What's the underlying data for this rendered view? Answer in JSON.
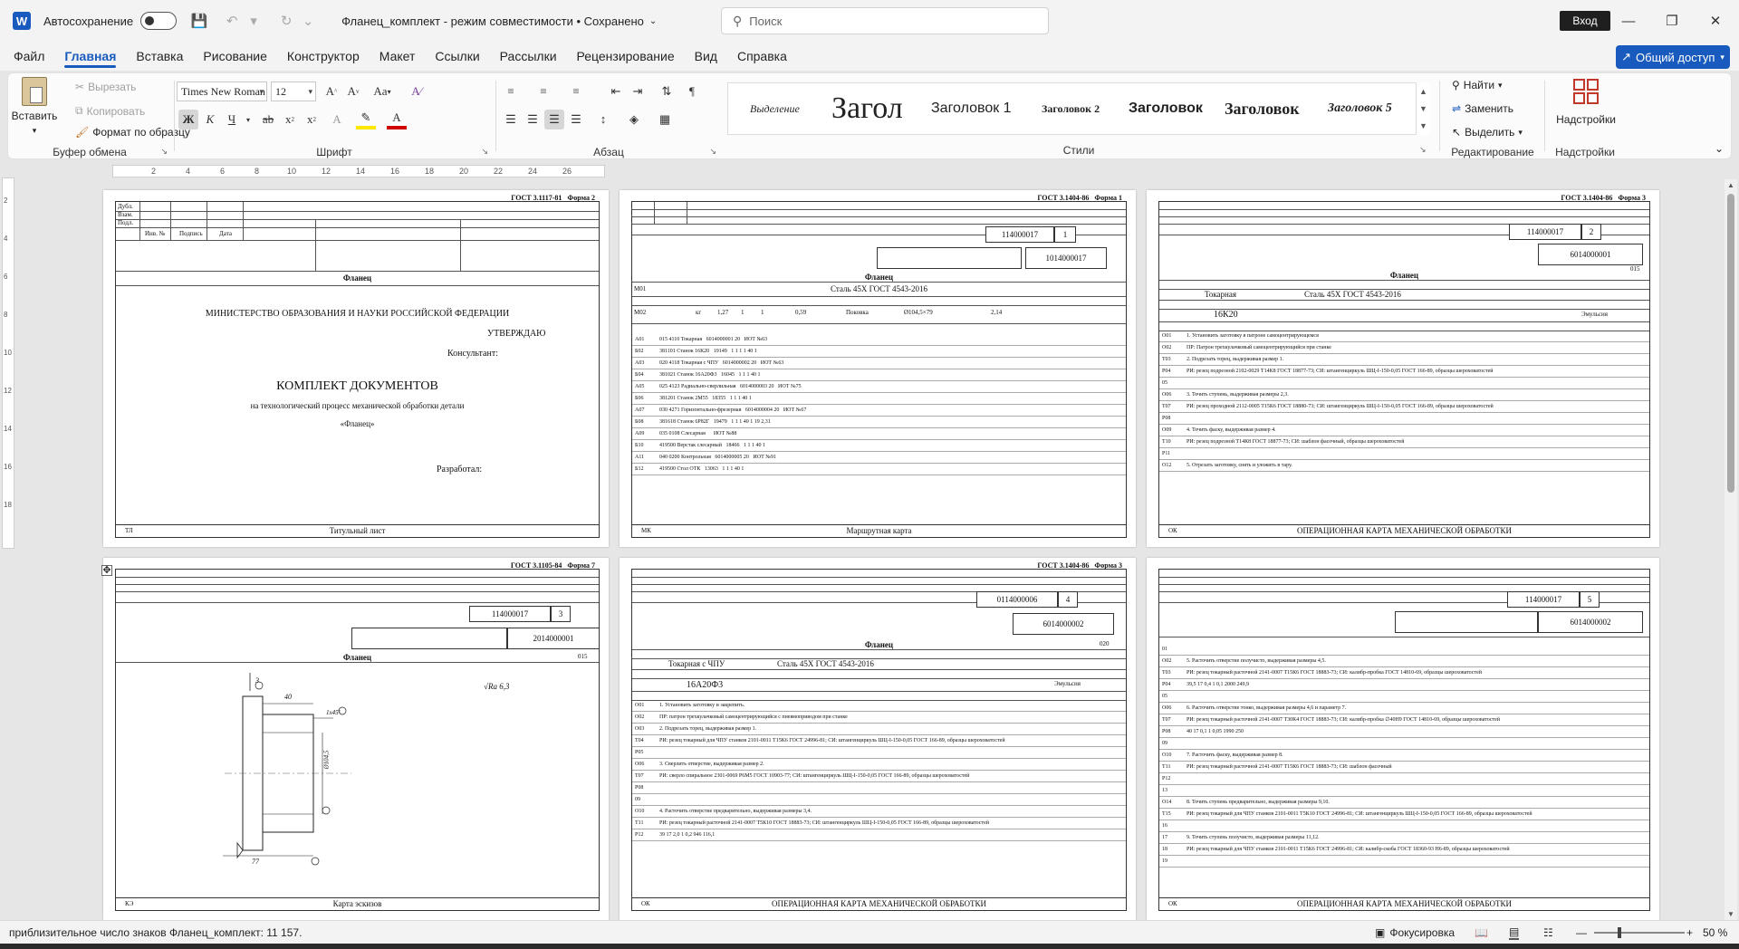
{
  "titlebar": {
    "app_icon": "W",
    "autosave_label": "Автосохранение",
    "doc_title": "Фланец_комплект  -  режим совместимости • Сохранено",
    "search_placeholder": "Поиск",
    "login_label": "Вход"
  },
  "menu": {
    "tabs": [
      "Файл",
      "Главная",
      "Вставка",
      "Рисование",
      "Конструктор",
      "Макет",
      "Ссылки",
      "Рассылки",
      "Рецензирование",
      "Вид",
      "Справка"
    ],
    "share_label": "Общий доступ"
  },
  "ribbon": {
    "clipboard": {
      "paste": "Вставить",
      "cut": "Вырезать",
      "copy": "Копировать",
      "format_painter": "Формат по образцу",
      "label": "Буфер обмена"
    },
    "font": {
      "font_name": "Times New Roman",
      "font_size": "12",
      "label": "Шрифт",
      "bold": "Ж",
      "italic": "К",
      "underline": "Ч"
    },
    "paragraph": {
      "label": "Абзац"
    },
    "styles": {
      "items": [
        "Выделение",
        "Загол",
        "Заголовок 1",
        "Заголовок 2",
        "Заголовок 3",
        "Заголовок",
        "Заголовок 5"
      ],
      "label": "Стили"
    },
    "editing": {
      "find": "Найти",
      "replace": "Заменить",
      "select": "Выделить",
      "label": "Редактирование"
    },
    "addins": {
      "button": "Надстройки",
      "label": "Надстройки"
    }
  },
  "ruler": {
    "marks": [
      "2",
      "4",
      "6",
      "8",
      "10",
      "12",
      "14",
      "16",
      "18",
      "20",
      "22",
      "24",
      "26"
    ]
  },
  "vruler": {
    "marks": [
      "2",
      "4",
      "6",
      "8",
      "10",
      "12",
      "14",
      "16",
      "18"
    ]
  },
  "pages": {
    "p1": {
      "gost": "ГОСТ 3.1117-81",
      "forma": "Форма 2",
      "part": "Фланец",
      "ministry": "МИНИСТЕРСТВО ОБРАЗОВАНИЯ И НАУКИ РОССИЙСКОЙ ФЕДЕРАЦИИ",
      "approve": "УТВЕРЖДАЮ",
      "consultant": "Консультант:",
      "title": "КОМПЛЕКТ ДОКУМЕНТОВ",
      "subtitle": "на технологический процесс механической обработки детали",
      "part_quoted": "«Фланец»",
      "developer": "Разработал:",
      "footer": "Титульный лист",
      "tl": "ТЛ",
      "labels": [
        "Дубл.",
        "Взам.",
        "Подл.",
        "Инв. №",
        "Подпись",
        "Дата"
      ]
    },
    "p2": {
      "gost": "ГОСТ 3.1404-86",
      "forma": "Форма 1",
      "doc1": "114000017",
      "sheet": "1",
      "doc2": "1014000017",
      "part": "Фланец",
      "material": "Сталь 45Х ГОСТ 4543-2016",
      "m01": "М01",
      "m02": "М02",
      "footer": "Маршрутная карта",
      "mk": "МК",
      "mat_vals": [
        "кг",
        "1,27",
        "1",
        "1",
        "0,59",
        "Поковка",
        "Ø104,5×79",
        "2,14"
      ],
      "rows": [
        [
          "А01",
          "015 4110 Токарная",
          "6014000001 20",
          "ИОТ №63"
        ],
        [
          "Б02",
          "381101 Станок 16К20",
          "19149",
          "1 1 1 1 40 1"
        ],
        [
          "А03",
          "020 4118 Токарная с ЧПУ",
          "6014000002 20",
          "ИОТ №63"
        ],
        [
          "Б04",
          "381021 Станок 16А20Ф3",
          "16045",
          "1 1 1 40 1"
        ],
        [
          "А05",
          "025 4123 Радиально-сверлильная",
          "6014000003 20",
          "ИОТ №75"
        ],
        [
          "Б06",
          "381201 Станок 2М55",
          "18355",
          "1 1 1 40 1"
        ],
        [
          "А07",
          "030 4271 Горизонтально-фрезерная",
          "6014000004 20",
          "ИОТ №67"
        ],
        [
          "Б08",
          "381618 Станок 6Р82Г",
          "19479",
          "1 1 1 40 1 19 2,31"
        ],
        [
          "А09",
          "035 0108 Слесарная",
          "",
          "ИОТ №88"
        ],
        [
          "Б10",
          "419500 Верстак слесарный",
          "18466",
          "1 1 1 40 1"
        ],
        [
          "А11",
          "040 0200 Контрольная",
          "6014000005 20",
          "ИОТ №91"
        ],
        [
          "Б12",
          "419500 Стол ОТК",
          "13063",
          "1 1 1 40 1"
        ]
      ]
    },
    "p3": {
      "gost": "ГОСТ 3.1404-86",
      "forma": "Форма 3",
      "doc1": "114000017",
      "sheet": "2",
      "doc2": "6014000001",
      "part": "Фланец",
      "op_no": "015",
      "operation": "Токарная",
      "material": "Сталь 45Х ГОСТ 4543-2016",
      "equipment": "16К20",
      "coolant": "Эмульсия",
      "footer": "ОПЕРАЦИОННАЯ КАРТА МЕХАНИЧЕСКОЙ ОБРАБОТКИ",
      "ok": "ОК",
      "rows": [
        [
          "О01",
          "1. Установить заготовку в патроне самоцентрирующемся"
        ],
        [
          "О02",
          "ПР: Патрон трехкулачковый самоцентрирующийся при станке"
        ],
        [
          "Т03",
          "2. Подрезать торец, выдерживая размер 1."
        ],
        [
          "Р04",
          "РИ: резец подрезной 2102-0029 Т14К8 ГОСТ 18877-73;  СИ: штангенциркуль ШЦ-I-150-0,05 ГОСТ 166-89, образцы шероховатостей"
        ],
        [
          "05",
          ""
        ],
        [
          "О06",
          "3. Точить ступень, выдерживая размеры 2,3."
        ],
        [
          "Т07",
          "РИ: резец проходной 2112-0005 Т15К6 ГОСТ 18880-73;  СИ: штангенциркуль ШЦ-I-150-0,05 ГОСТ 166-89, образцы шероховатостей"
        ],
        [
          "Р08",
          ""
        ],
        [
          "О09",
          "4. Точить фаску, выдерживая размер 4."
        ],
        [
          "Т10",
          "РИ: резец подрезной Т14К8 ГОСТ 18877-73;  СИ: шаблон фасочный, образцы шероховатостей"
        ],
        [
          "Р11",
          ""
        ],
        [
          "О12",
          "5. Отрезать заготовку, снять и уложить в тару."
        ]
      ]
    },
    "p4": {
      "gost": "ГОСТ 3.1105-84",
      "forma": "Форма 7",
      "doc1": "114000017",
      "sheet": "3",
      "doc2": "2014000001",
      "part": "Фланец",
      "op_no": "015",
      "roughness": "Ra 6,3",
      "dims": [
        "40",
        "1х45°",
        "Ø104,5",
        "77",
        "3"
      ],
      "footer": "Карта эскизов",
      "ke": "КЭ"
    },
    "p5": {
      "gost": "ГОСТ 3.1404-86",
      "forma": "Форма 3",
      "doc1": "0114000006",
      "sheet": "4",
      "doc2": "6014000002",
      "part": "Фланец",
      "op_no": "020",
      "operation": "Токарная с ЧПУ",
      "material": "Сталь 45Х ГОСТ 4543-2016",
      "equipment": "16А20Ф3",
      "coolant": "Эмульсия",
      "footer": "ОПЕРАЦИОННАЯ КАРТА МЕХАНИЧЕСКОЙ ОБРАБОТКИ",
      "ok": "ОК",
      "rows": [
        [
          "О01",
          "1. Установить заготовку и закрепить."
        ],
        [
          "О02",
          "ПР: патрон трехкулачковый самоцентрирующийся с пневмоприводом при станке"
        ],
        [
          "О03",
          "2. Подрезать торец, выдерживая размер 1."
        ],
        [
          "Т04",
          "РИ: резец токарный для ЧПУ станков 2101-0011 Т15К6 ГОСТ 24996-81;  СИ: штангенциркуль ШЦ-I-150-0,05 ГОСТ 166-89, образцы шероховатостей"
        ],
        [
          "Р05",
          ""
        ],
        [
          "О06",
          "3. Сверлить отверстие, выдерживая размер 2."
        ],
        [
          "Т07",
          "РИ: сверло спиральное 2301-0069 Р6М5 ГОСТ 10903-77;  СИ: штангенциркуль ШЦ-I-150-0,05 ГОСТ 166-89, образцы шероховатостей"
        ],
        [
          "Р08",
          ""
        ],
        [
          "09",
          ""
        ],
        [
          "О10",
          "4. Расточить отверстие предварительно, выдерживая размеры 3,4."
        ],
        [
          "Т11",
          "РИ: резец токарный расточной 2141-0007 Т5К10 ГОСТ 18883-73;  СИ: штангенциркуль ШЦ-I-150-0,05 ГОСТ 166-89, образцы шероховатостей"
        ],
        [
          "Р12",
          "39    17    2,0    1    0,2    946    116,1"
        ]
      ]
    },
    "p6": {
      "doc1": "114000017",
      "sheet": "5",
      "doc2": "6014000002",
      "footer": "ОПЕРАЦИОННАЯ КАРТА МЕХАНИЧЕСКОЙ ОБРАБОТКИ",
      "ok": "ОК",
      "rows": [
        [
          "01",
          ""
        ],
        [
          "О02",
          "5. Расточить отверстие получисто, выдерживая размеры 4,5."
        ],
        [
          "Т03",
          "РИ: резец токарный расточной 2141-0007 Т15К6 ГОСТ 18883-73;  СИ: калибр-пробка ГОСТ 14810-69, образцы шероховатостей"
        ],
        [
          "Р04",
          "39,5   17   0,4   1   0,1   2000   249,9"
        ],
        [
          "05",
          ""
        ],
        [
          "О06",
          "6. Расточить отверстие тонко, выдерживая размеры 4,6 и параметр 7."
        ],
        [
          "Т07",
          "РИ: резец токарный расточной 2141-0007 Т30К4 ГОСТ 18883-73;  СИ: калибр-пробка ∅40Н9 ГОСТ 14810-69, образцы шероховатостей"
        ],
        [
          "Р08",
          "40   17   0,1   1   0,05   1990   250"
        ],
        [
          "09",
          ""
        ],
        [
          "О10",
          "7. Расточить фаску, выдерживая размер 8."
        ],
        [
          "Т11",
          "РИ: резец токарный расточной 2141-0007 Т15К6 ГОСТ 18883-73;  СИ: шаблон фасочный"
        ],
        [
          "Р12",
          ""
        ],
        [
          "13",
          ""
        ],
        [
          "О14",
          "8. Точить ступень предварительно, выдерживая размеры 9,10."
        ],
        [
          "Т15",
          "РИ: резец токарный для ЧПУ станков 2101-0011 Т5К10 ГОСТ 24996-81;  СИ: штангенциркуль ШЦ-I-150-0,05 ГОСТ 166-89, образцы шероховатостей"
        ],
        [
          "16",
          ""
        ],
        [
          "17",
          "9. Точить ступень получисто, выдерживая размеры 11,12."
        ],
        [
          "18",
          "РИ: резец токарный для ЧПУ станков 2101-0011 Т15К6 ГОСТ 24996-81;  СИ: калибр-скоба ГОСТ 18360-93 Н6-89, образцы шероховатостей"
        ],
        [
          "19",
          ""
        ]
      ]
    }
  },
  "statusbar": {
    "word_count": "приблизительное число знаков Фланец_комплект: 11 157.",
    "focus": "Фокусировка",
    "zoom": "50 %"
  }
}
